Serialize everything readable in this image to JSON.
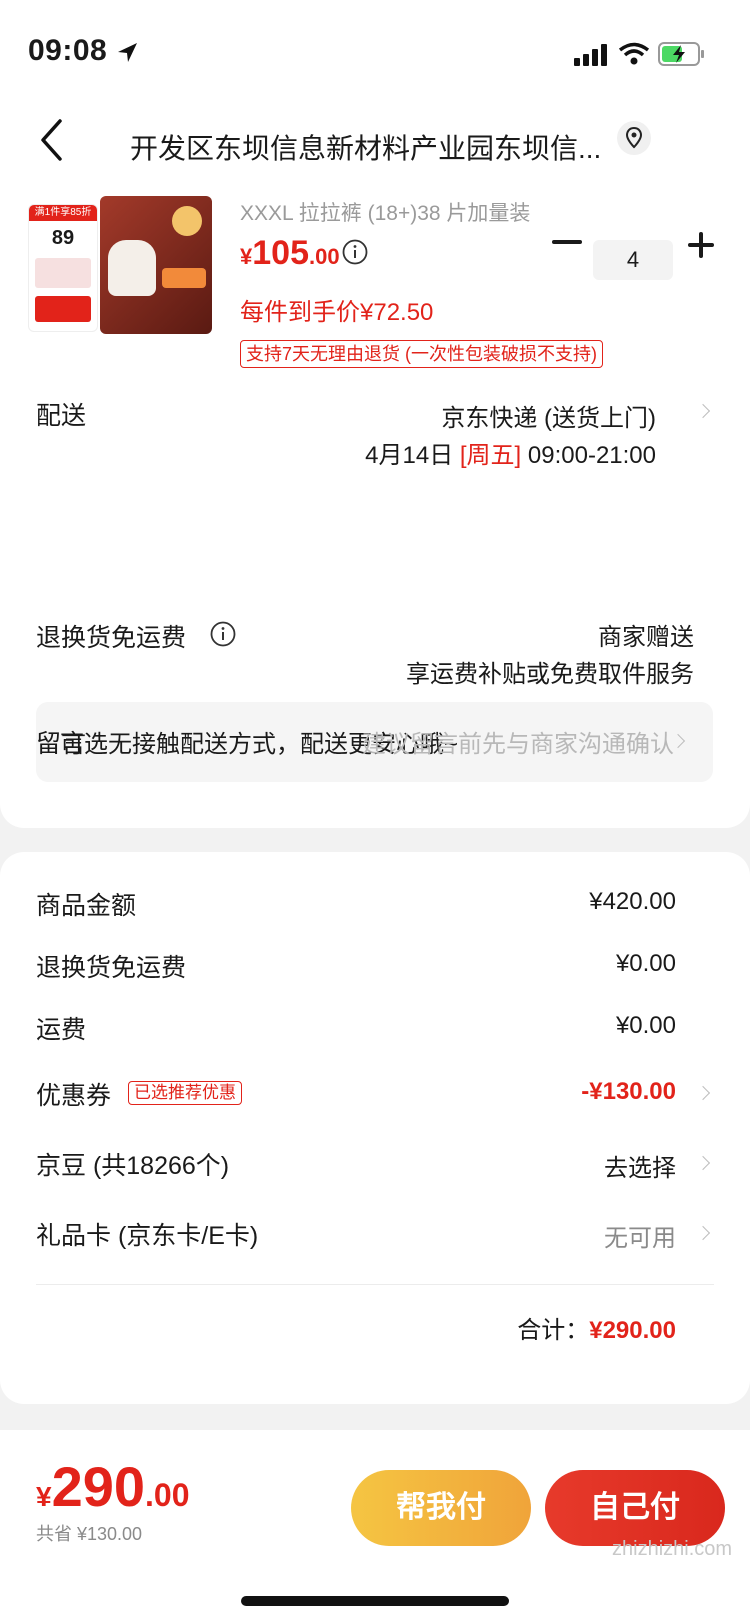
{
  "status_bar": {
    "time": "09:08"
  },
  "nav": {
    "title": "开发区东坝信息新材料产业园东坝信..."
  },
  "product": {
    "sku": "XXXL 拉拉裤 (18+)38 片加量装",
    "price_symbol": "¥",
    "price_int": "105",
    "price_dec": ".00",
    "unit_price": "每件到手价¥72.50",
    "return_policy": "支持7天无理由退货 (一次性包装破损不支持)",
    "quantity": "4",
    "thumb_badge": "满1件享85折",
    "thumb_price": "89"
  },
  "delivery": {
    "label": "配送",
    "method": "京东快递 (送货上门)",
    "date_prefix": "4月14日",
    "date_weekday": "[周五]",
    "date_time": "09:00-21:00",
    "contactless": "可选无接触配送方式，配送更安心哦~"
  },
  "return_shipping": {
    "label": "退换货免运费",
    "value": "商家赠送",
    "sub": "享运费补贴或免费取件服务"
  },
  "message": {
    "label": "留言",
    "placeholder": "建议留言前先与商家沟通确认"
  },
  "totals": {
    "goods_label": "商品金额",
    "goods_value": "¥420.00",
    "return_label": "退换货免运费",
    "return_value": "¥0.00",
    "shipping_label": "运费",
    "shipping_value": "¥0.00",
    "coupon_label": "优惠券",
    "coupon_tag": "已选推荐优惠",
    "coupon_value": "-¥130.00",
    "beans_label": "京豆 (共18266个)",
    "beans_value": "去选择",
    "gift_label": "礼品卡 (京东卡/E卡)",
    "gift_value": "无可用",
    "sum_label": "合计：",
    "sum_value": "¥290.00"
  },
  "bottom": {
    "price_symbol": "¥",
    "price_int": "290",
    "price_dec": ".00",
    "saved": "共省 ¥130.00",
    "help_pay": "帮我付",
    "self_pay": "自己付",
    "watermark": "zhizhizhi.com"
  },
  "colors": {
    "accent": "#e2231a",
    "help_pay": "#f5c542",
    "self_pay": "#e2231a"
  }
}
